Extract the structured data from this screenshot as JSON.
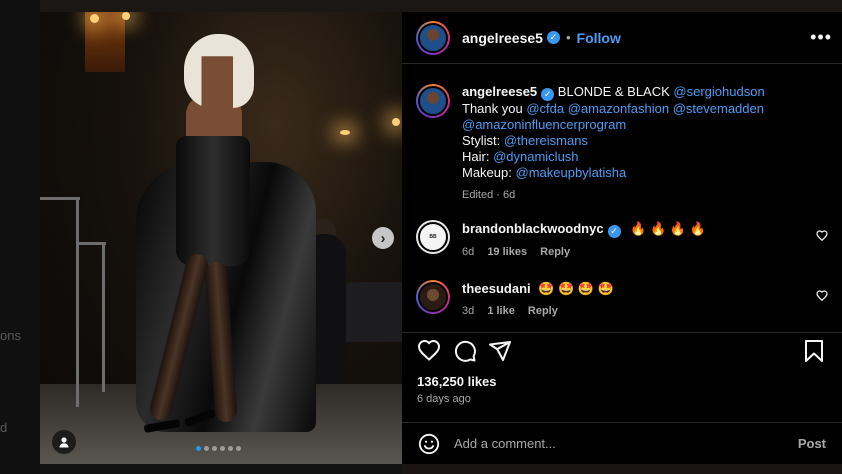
{
  "background": {
    "left_text_1": "ons",
    "left_text_2": "d"
  },
  "post": {
    "author": "angelreese5",
    "follow_label": "Follow",
    "separator": "•",
    "more_icon": "more-horizontal-icon",
    "caption": {
      "username": "angelreese5",
      "lead": "BLONDE & BLACK",
      "mention_1": "@sergiohudson",
      "thank_you": "Thank you",
      "mention_cfda": "@cfda",
      "mention_amazonfashion": "@amazonfashion",
      "mention_stevemadden": "@stevemadden",
      "mention_amazoninfluencer": "@amazoninfluencerprogram",
      "stylist_label": "Stylist:",
      "stylist": "@thereismans",
      "hair_label": "Hair:",
      "hair": "@dynamiclush",
      "makeup_label": "Makeup:",
      "makeup": "@makeupbylatisha",
      "meta": "Edited · 6d"
    },
    "comments": [
      {
        "username": "brandonblackwoodnyc",
        "text": "🔥 🔥 🔥 🔥",
        "age": "6d",
        "likes": "19 likes",
        "reply": "Reply",
        "verified": true
      },
      {
        "username": "theesudani",
        "text": "🤩 🤩 🤩 🤩",
        "age": "3d",
        "likes": "1 like",
        "reply": "Reply",
        "verified": false
      }
    ],
    "likes": "136,250 likes",
    "posted": "6 days ago",
    "add_comment_placeholder": "Add a comment...",
    "post_label": "Post",
    "carousel": {
      "total": 6,
      "active": 0
    },
    "accent_color": "#4a9df5"
  }
}
